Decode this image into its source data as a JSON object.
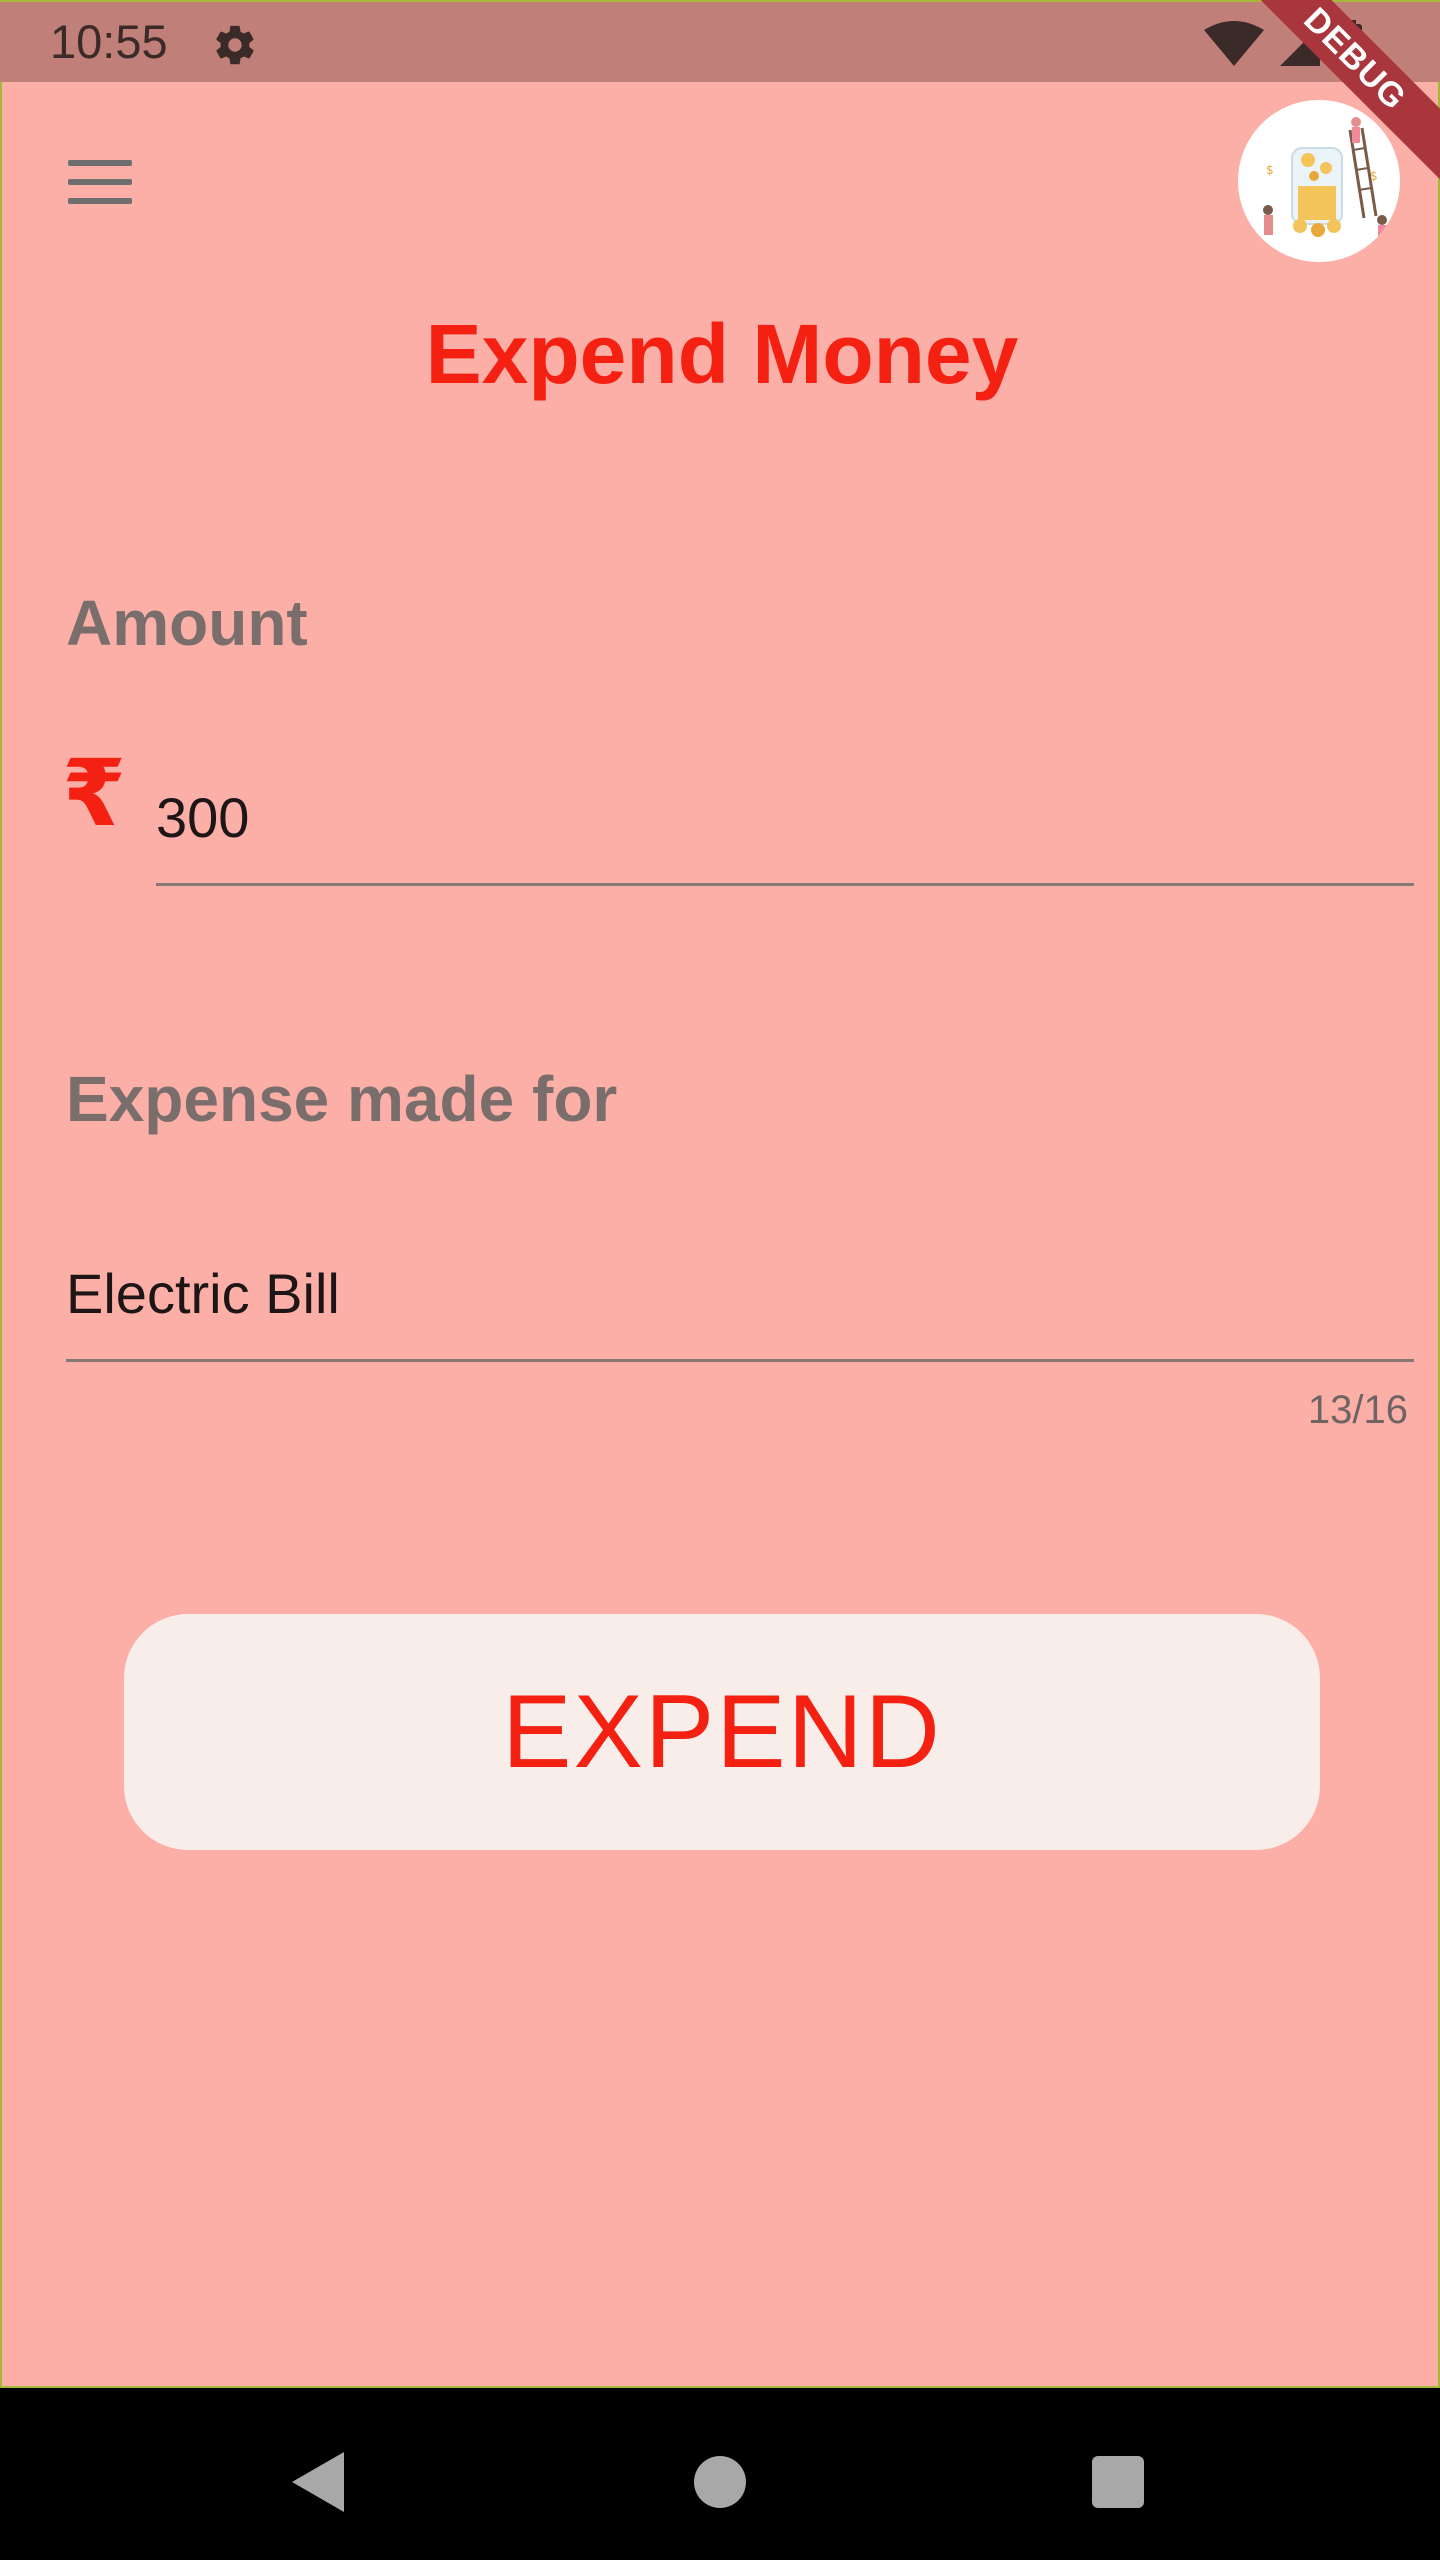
{
  "status_bar": {
    "time": "10:55",
    "icons": [
      "settings-gear-icon",
      "wifi-icon",
      "cell-signal-icon",
      "battery-icon"
    ]
  },
  "debug_banner": "DEBUG",
  "header": {
    "menu_icon": "hamburger-menu-icon",
    "avatar_icon": "money-jar-illustration",
    "title": "Expend Money"
  },
  "form": {
    "amount": {
      "label": "Amount",
      "currency_symbol": "₹",
      "value": "300"
    },
    "expense_for": {
      "label": "Expense made for",
      "value": "Electric Bill",
      "counter": "13/16"
    },
    "submit_label": "EXPEND"
  },
  "colors": {
    "background": "#fcafa6",
    "accent": "#f42012",
    "button_bg": "#f9ede9",
    "label_gray": "#7a6e6d"
  },
  "nav_bar": {
    "icons": [
      "back-triangle-icon",
      "home-circle-icon",
      "recents-square-icon"
    ]
  }
}
